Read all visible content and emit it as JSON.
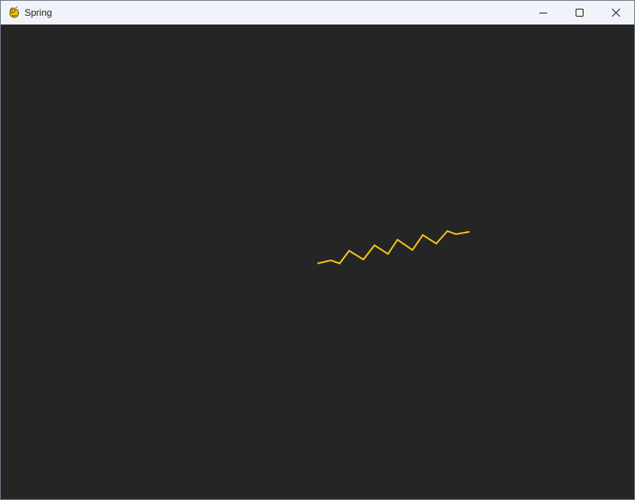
{
  "window": {
    "title": "Spring",
    "title_icon": "pygame-snake-icon",
    "controls": [
      "minimize-icon",
      "maximize-icon",
      "close-icon"
    ]
  },
  "canvas": {
    "background": "#252525",
    "spring_color": "#f5c518"
  }
}
